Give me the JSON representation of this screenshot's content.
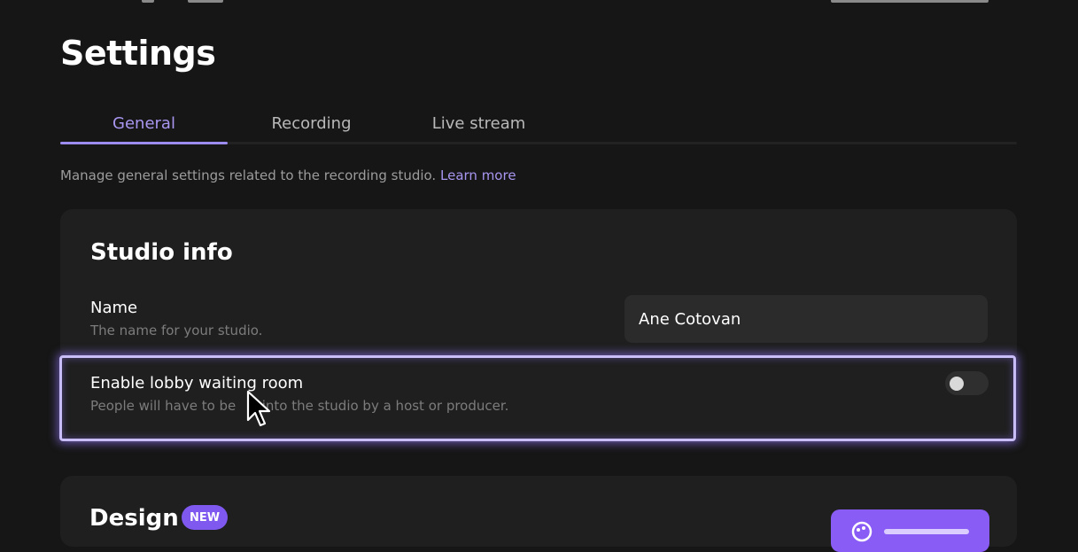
{
  "page": {
    "title": "Settings"
  },
  "tabs": [
    {
      "label": "General",
      "active": true
    },
    {
      "label": "Recording",
      "active": false
    },
    {
      "label": "Live stream",
      "active": false
    }
  ],
  "description": {
    "text": "Manage general settings related to the recording studio.",
    "link": "Learn more"
  },
  "studio_info": {
    "title": "Studio info",
    "name": {
      "label": "Name",
      "sub": "The name for your studio.",
      "value": "Ane Cotovan"
    },
    "lobby": {
      "label": "Enable lobby waiting room",
      "sub_before": "People will have to be ",
      "sub_after": "t into the studio by a host or producer.",
      "enabled": false
    }
  },
  "design": {
    "title": "Design",
    "badge": "NEW",
    "button_icon": "customize-icon"
  },
  "colors": {
    "background": "#161616",
    "card": "#1f1f1f",
    "accent": "#a996f0",
    "highlight_border": "#c9bdf7",
    "badge": "#7e58ef",
    "button": "#8a5cf6"
  }
}
